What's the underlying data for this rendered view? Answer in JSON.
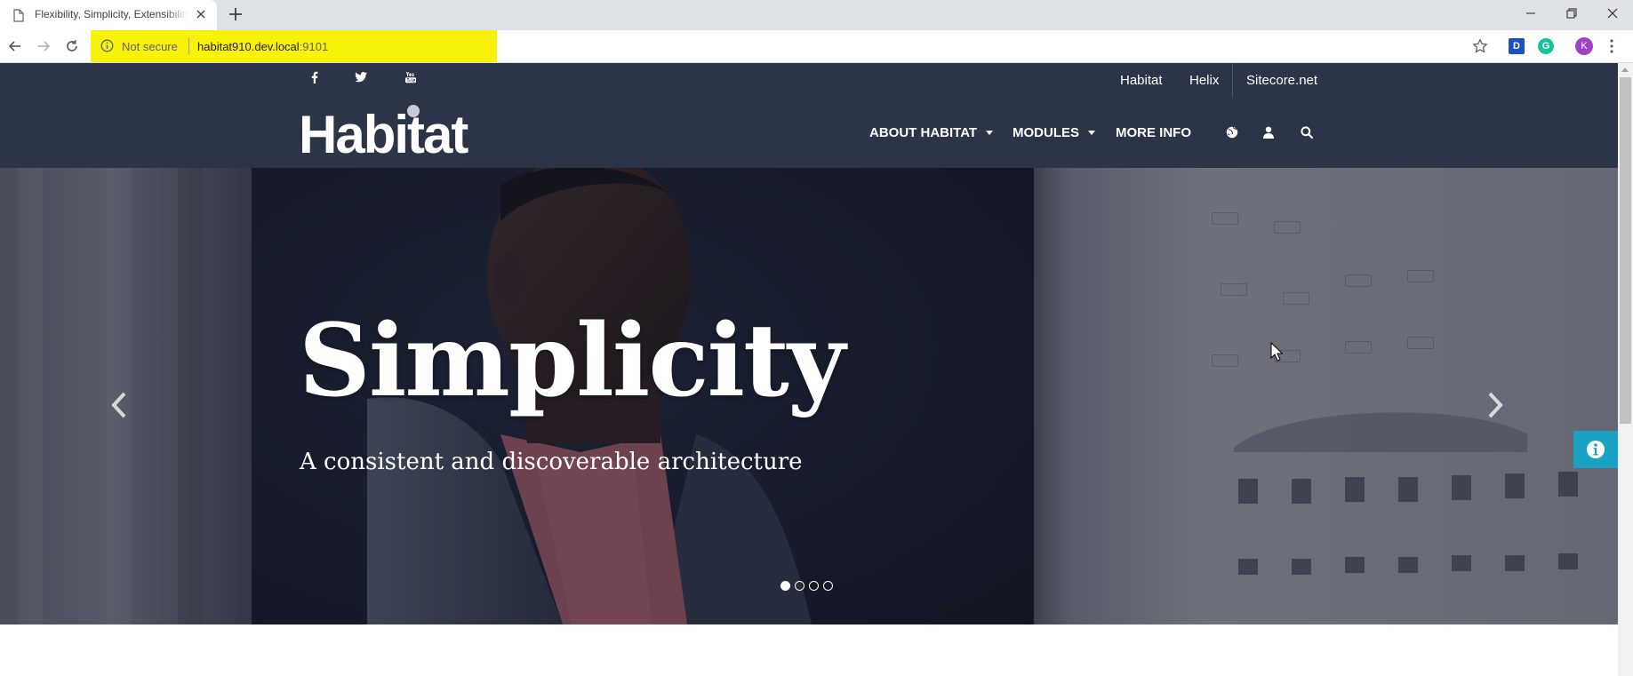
{
  "browser": {
    "tab_title": "Flexibility, Simplicity, Extensibility",
    "security_label": "Not secure",
    "url_host": "habitat910.dev.local",
    "url_port": ":9101",
    "profile_initial": "K",
    "extension_d": "D",
    "extension_g": "G"
  },
  "site": {
    "top_links": [
      "Habitat",
      "Helix",
      "Sitecore.net"
    ],
    "logo_text": "Habitat",
    "nav": {
      "about": "ABOUT HABITAT",
      "modules": "MODULES",
      "more": "MORE INFO"
    },
    "social_icons": [
      "facebook-icon",
      "twitter-icon",
      "youtube-icon"
    ],
    "utility_icons": [
      "globe-icon",
      "user-icon",
      "search-icon"
    ],
    "header_color": "#2b3547",
    "info_tab_color": "#1ba1c4"
  },
  "hero": {
    "title": "Simplicity",
    "subtitle": "A consistent and discoverable architecture",
    "slide_count": 4,
    "active_slide": 1
  }
}
